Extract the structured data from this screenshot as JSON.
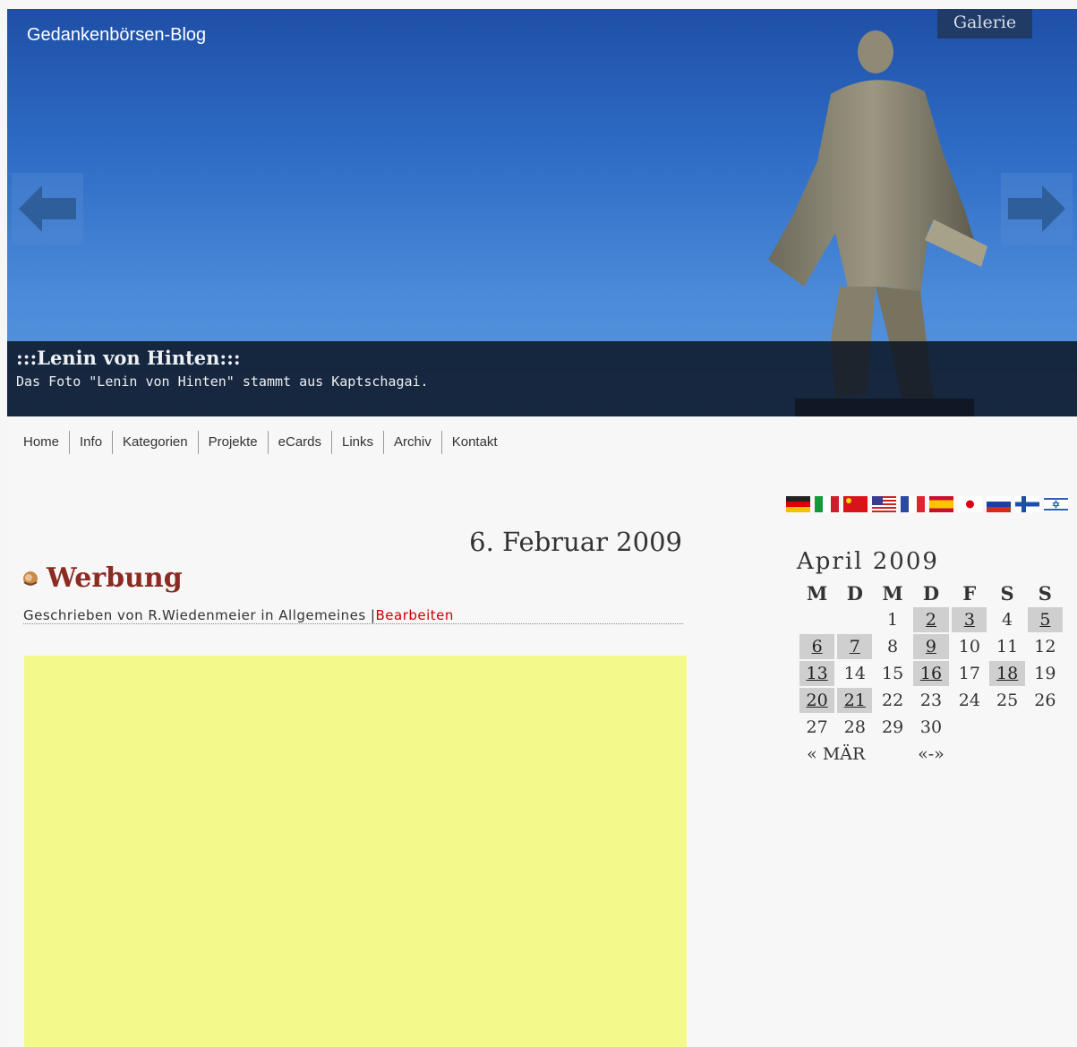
{
  "header": {
    "blog_title": "Gedankenbörsen-Blog",
    "gallery_label": "Galerie"
  },
  "slide": {
    "title": ":::Lenin von Hinten:::",
    "text": "Das Foto \"Lenin von Hinten\" stammt aus Kaptschagai."
  },
  "nav": {
    "items": [
      "Home",
      "Info",
      "Kategorien",
      "Projekte",
      "eCards",
      "Links",
      "Archiv",
      "Kontakt"
    ]
  },
  "post": {
    "date": "6. Februar 2009",
    "title": "Werbung",
    "meta_prefix": "Geschrieben von R.Wiedenmeier in Allgemeines |",
    "edit_label": "Bearbeiten"
  },
  "languages": [
    "Deutsch",
    "Italiano",
    "中文",
    "English",
    "Français",
    "Español",
    "日本語",
    "Русский",
    "Suomi",
    "עברית"
  ],
  "calendar": {
    "caption": "April 2009",
    "weekdays": [
      "M",
      "D",
      "M",
      "D",
      "F",
      "S",
      "S"
    ],
    "weeks": [
      [
        "",
        "",
        "1",
        "2",
        "3",
        "4",
        "5"
      ],
      [
        "6",
        "7",
        "8",
        "9",
        "10",
        "11",
        "12"
      ],
      [
        "13",
        "14",
        "15",
        "16",
        "17",
        "18",
        "19"
      ],
      [
        "20",
        "21",
        "22",
        "23",
        "24",
        "25",
        "26"
      ],
      [
        "27",
        "28",
        "29",
        "30",
        "",
        "",
        ""
      ]
    ],
    "post_days": [
      "2",
      "3",
      "5",
      "6",
      "7",
      "9",
      "13",
      "16",
      "18",
      "20",
      "21"
    ],
    "prev_label": "« MÄR",
    "next_label": "«-»"
  },
  "colors": {
    "title_red": "#8b2b22",
    "link_red": "#cc0000",
    "ad_yellow": "#f4f98c"
  }
}
